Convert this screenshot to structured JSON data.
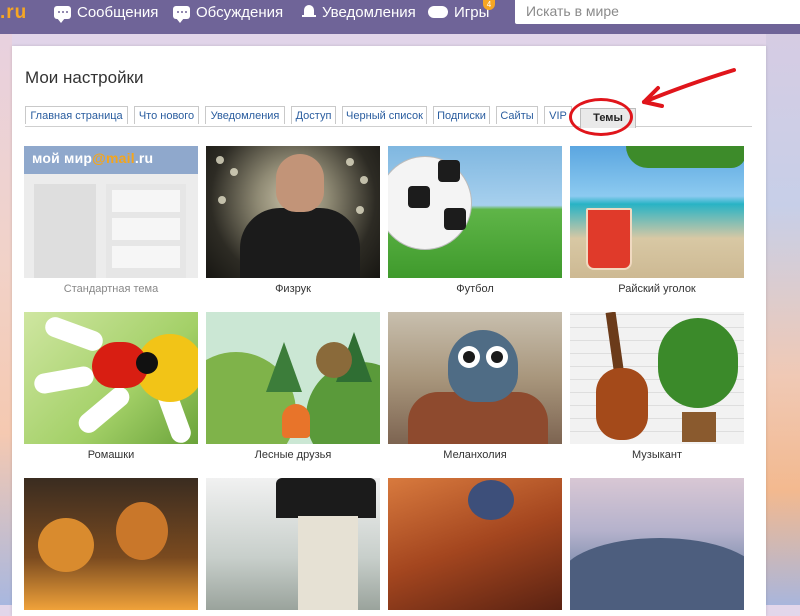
{
  "topbar": {
    "logo": ".ru",
    "nav": [
      {
        "label": "Сообщения",
        "icon": "chat-icon"
      },
      {
        "label": "Обсуждения",
        "icon": "discussion-icon"
      },
      {
        "label": "Уведомления",
        "icon": "bell-icon"
      },
      {
        "label": "Игры",
        "icon": "gamepad-icon",
        "badge": "4"
      }
    ],
    "search_placeholder": "Искать в мире"
  },
  "settings": {
    "title": "Мои настройки",
    "tabs": [
      {
        "label": "Главная страница"
      },
      {
        "label": "Что нового"
      },
      {
        "label": "Уведомления"
      },
      {
        "label": "Доступ"
      },
      {
        "label": "Черный список"
      },
      {
        "label": "Подписки"
      },
      {
        "label": "Сайты"
      },
      {
        "label": "VIP"
      },
      {
        "label": "Темы",
        "active": true
      }
    ]
  },
  "themes": {
    "standard_logo_a": "мой мир",
    "standard_logo_b": "@mail",
    "standard_logo_c": ".ru",
    "items": [
      {
        "label": "Стандартная тема"
      },
      {
        "label": "Физрук"
      },
      {
        "label": "Футбол"
      },
      {
        "label": "Райский уголок"
      },
      {
        "label": "Ромашки"
      },
      {
        "label": "Лесные друзья"
      },
      {
        "label": "Меланхолия"
      },
      {
        "label": "Музыкант"
      }
    ]
  },
  "colors": {
    "topbar": "#6f6498",
    "accent_orange": "#f6a623",
    "link_blue": "#2a5d9f",
    "annotation_red": "#e0151b"
  }
}
